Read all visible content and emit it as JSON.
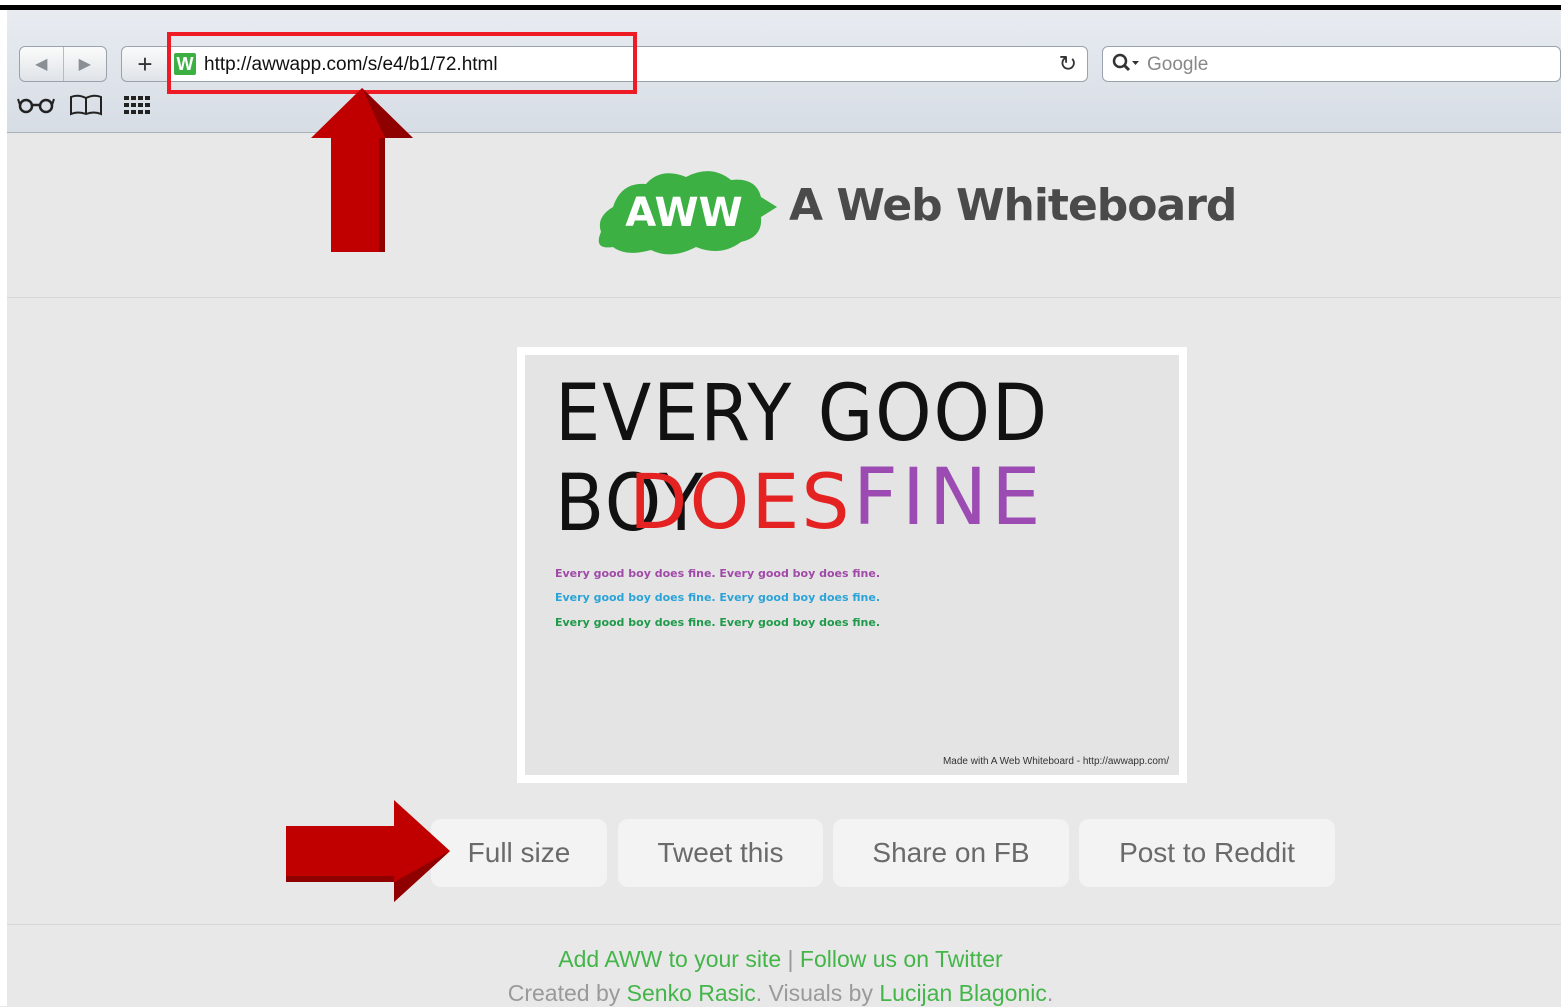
{
  "browser": {
    "url": "http://awwapp.com/s/e4/b1/72.html",
    "favicon_letter": "W",
    "search_placeholder": "Google",
    "back_icon": "◀",
    "forward_icon": "▶",
    "add_icon": "+",
    "reload_icon": "↻",
    "search_icon_glyph": "🔍▾",
    "bookmarks": [
      "reading-list-icon",
      "bookmarks-book-icon",
      "top-sites-grid-icon"
    ]
  },
  "header": {
    "logo_mark": "AWW",
    "logo_title": "A Web Whiteboard"
  },
  "board": {
    "line1": "EVERY GOOD BOY",
    "line2a": "DOES",
    "line2b": "FINE",
    "small_lines": [
      {
        "text": "Every good boy does fine.  Every good boy does fine.",
        "color": "#a04aa8"
      },
      {
        "text": "Every good boy does fine.  Every good boy does fine.",
        "color": "#2aa3d8"
      },
      {
        "text": "Every good boy does fine.  Every good boy does fine.",
        "color": "#1f9a4a"
      }
    ],
    "watermark": "Made with A Web Whiteboard - http://awwapp.com/"
  },
  "actions": {
    "full_size": "Full size",
    "tweet": "Tweet this",
    "share_fb": "Share on FB",
    "reddit": "Post to Reddit"
  },
  "footer": {
    "add_site": "Add AWW to your site",
    "separator": " | ",
    "follow": "Follow us on Twitter",
    "created_by": "Created by ",
    "author1": "Senko Rasic",
    "visuals_by": ". Visuals by ",
    "author2": "Lucijan Blagonic",
    "end": "."
  },
  "colors": {
    "annotation_red": "#ee1b24",
    "arrow_red": "#c00000",
    "brand_green": "#43b549"
  }
}
